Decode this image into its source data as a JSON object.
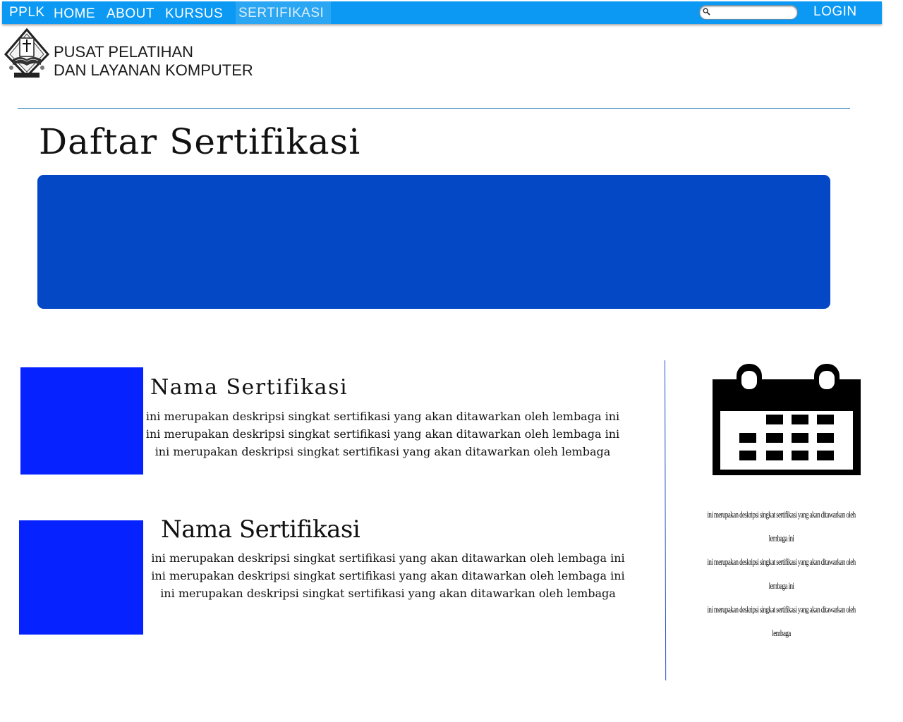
{
  "navbar": {
    "brand": "PPLK",
    "links": {
      "home": "HOME",
      "about": "ABOUT",
      "kursus": "KURSUS",
      "sertifikasi": "SERTIFIKASI"
    },
    "active_link": "SERTIFIKASI",
    "search": {
      "value": "",
      "placeholder": ""
    },
    "login": "LOGIN",
    "colors": {
      "bar": "#0b99f3",
      "text": "#ffffff"
    }
  },
  "header": {
    "org_name_line1": "PUSAT PELATIHAN",
    "org_name_line2": "DAN LAYANAN KOMPUTER",
    "logo_icon": "university-shield-logo-icon"
  },
  "main": {
    "title": "Daftar Sertifikasi",
    "banner_color": "#0448c6",
    "certifications": [
      {
        "title": "Nama Sertifikasi",
        "description": "ini merupakan deskripsi singkat sertifikasi yang akan ditawarkan oleh lembaga ini\nini merupakan deskripsi singkat sertifikasi yang akan ditawarkan oleh lembaga ini\nini merupakan deskripsi singkat sertifikasi yang akan ditawarkan oleh lembaga",
        "thumb_color": "#0622ff"
      },
      {
        "title": "Nama Sertifikasi",
        "description": "ini merupakan deskripsi singkat sertifikasi yang akan ditawarkan oleh lembaga ini\nini merupakan deskripsi singkat sertifikasi yang akan ditawarkan oleh lembaga ini\nini merupakan deskripsi singkat sertifikasi yang akan ditawarkan oleh lembaga",
        "thumb_color": "#0622ff"
      }
    ]
  },
  "sidebar": {
    "icon": "calendar-icon",
    "description": "ini merupakan deskripsi singkat sertifikasi yang akan ditawarkan oleh lembaga ini\nini merupakan deskripsi singkat sertifikasi yang akan ditawarkan oleh lembaga ini\nini merupakan deskripsi singkat sertifikasi yang akan ditawarkan oleh lembaga"
  }
}
